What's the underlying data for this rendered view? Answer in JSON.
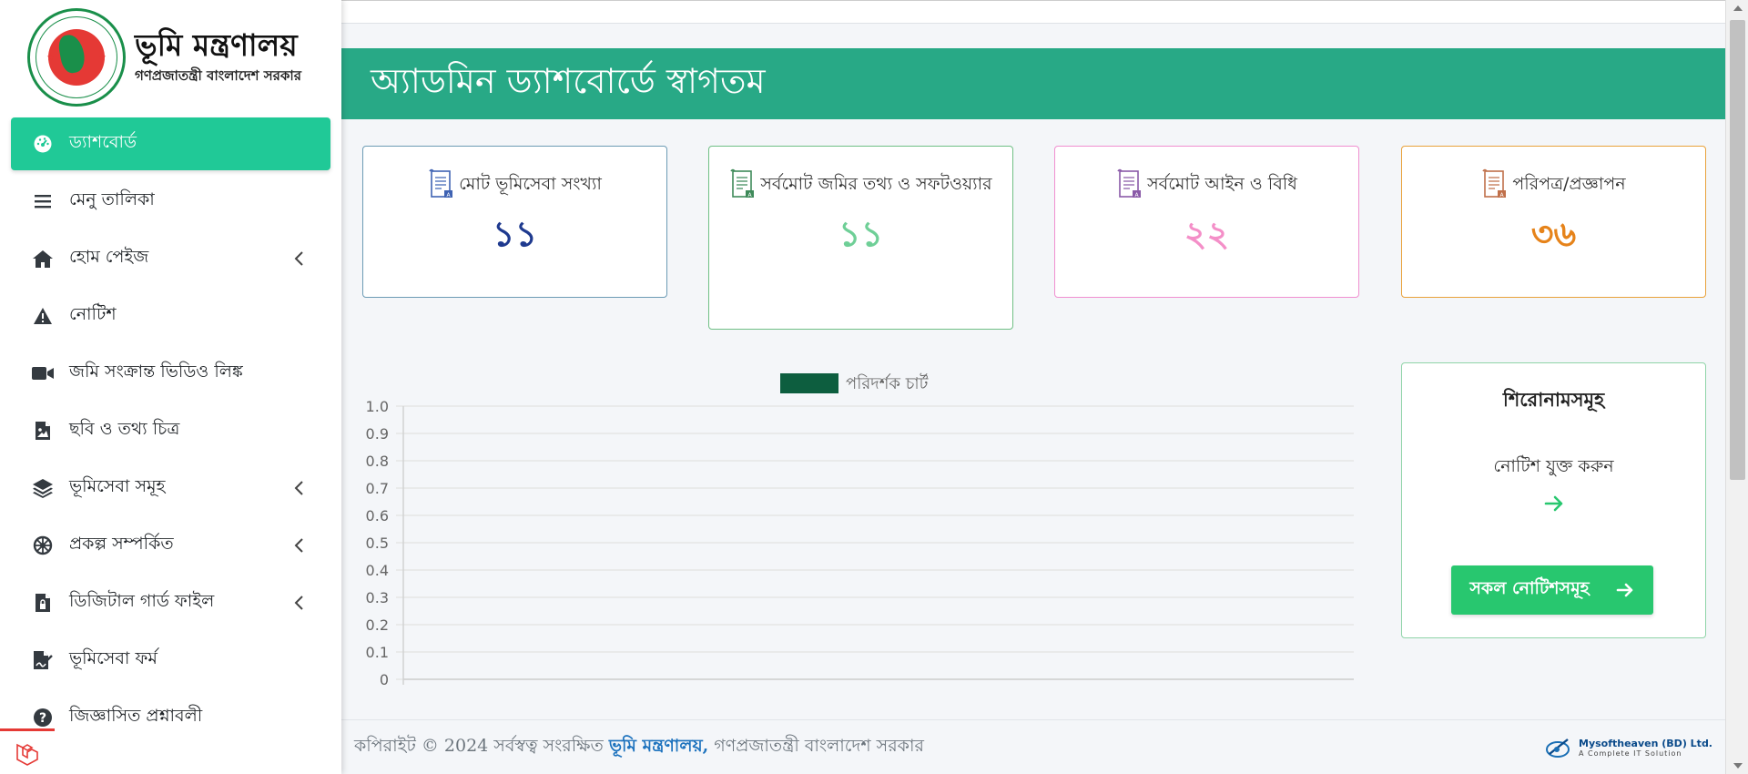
{
  "brand": {
    "title": "ভূমি মন্ত্রণালয়",
    "subtitle": "গণপ্রজাতন্ত্রী বাংলাদেশ সরকার",
    "seal_text": "গণপ্রজাতন্ত্রী বাংলাদেশ সরকার"
  },
  "sidebar": {
    "items": [
      {
        "label": "ড্যাশবোর্ড",
        "icon": "dashboard-icon",
        "active": true,
        "submenu": false
      },
      {
        "label": "মেনু তালিকা",
        "icon": "bars-icon",
        "active": false,
        "submenu": false
      },
      {
        "label": "হোম পেইজ",
        "icon": "home-icon",
        "active": false,
        "submenu": true
      },
      {
        "label": "নোটিশ",
        "icon": "warning-icon",
        "active": false,
        "submenu": false
      },
      {
        "label": "জমি সংক্রান্ত ভিডিও লিঙ্ক",
        "icon": "video-icon",
        "active": false,
        "submenu": false
      },
      {
        "label": "ছবি ও তথ্য চিত্র",
        "icon": "image-file-icon",
        "active": false,
        "submenu": false
      },
      {
        "label": "ভূমিসেবা সমূহ",
        "icon": "layers-icon",
        "active": false,
        "submenu": true
      },
      {
        "label": "প্রকল্প সম্পর্কিত",
        "icon": "wheel-icon",
        "active": false,
        "submenu": true
      },
      {
        "label": "ডিজিটাল গার্ড ফাইল",
        "icon": "file-lock-icon",
        "active": false,
        "submenu": true
      },
      {
        "label": "ভূমিসেবা ফর্ম",
        "icon": "file-signature-icon",
        "active": false,
        "submenu": false
      },
      {
        "label": "জিজ্ঞাসিত প্রশ্নাবলী",
        "icon": "question-icon",
        "active": false,
        "submenu": false
      }
    ]
  },
  "header": {
    "title": "অ্যাডমিন ড্যাশবোর্ডে স্বাগতম"
  },
  "stats": [
    {
      "label": "মোট ভূমিসেবা সংখ্যা",
      "count": "১১",
      "color": "#1f3a8f",
      "border": "#6c9bb5",
      "icon_color": "#3f63b3"
    },
    {
      "label": "সর্বমোট জমির তথ্য ও সফটওয়্যার",
      "count": "১১",
      "color": "#6fcf97",
      "border": "#6fbf85",
      "icon_color": "#3f8a5a"
    },
    {
      "label": "সর্বমোট আইন ও বিধি",
      "count": "২২",
      "color": "#f48fc8",
      "border": "#f08fd0",
      "icon_color": "#8a5aa8"
    },
    {
      "label": "পরিপত্র/প্রজ্ঞাপন",
      "count": "৩৬",
      "color": "#e6831a",
      "border": "#e9a23b",
      "icon_color": "#c0704a"
    }
  ],
  "chart_data": {
    "type": "bar",
    "categories": [],
    "series": [
      {
        "name": "পরিদর্শক চার্ট",
        "values": [],
        "color": "#0d5e3f"
      }
    ],
    "y_ticks": [
      "1.0",
      "0.9",
      "0.8",
      "0.7",
      "0.6",
      "0.5",
      "0.4",
      "0.3",
      "0.2",
      "0.1",
      "0"
    ],
    "ylim": [
      0,
      1.0
    ],
    "grid": true,
    "legend": "top-center"
  },
  "notice": {
    "title": "শিরোনামসমূহ",
    "text": "নোটিশ যুক্ত করুন",
    "button_label": "সকল নোটিশসমূহ"
  },
  "footer": {
    "prefix": "কপিরাইট © 2024 সর্বস্বত্ব সংরক্ষিত",
    "link": "ভূমি মন্ত্রণালয়,",
    "suffix": "গণপ্রজাতন্ত্রী বাংলাদেশ সরকার",
    "company": "Mysoftheaven (BD) Ltd.",
    "company_tag": "A Complete IT Solution"
  }
}
